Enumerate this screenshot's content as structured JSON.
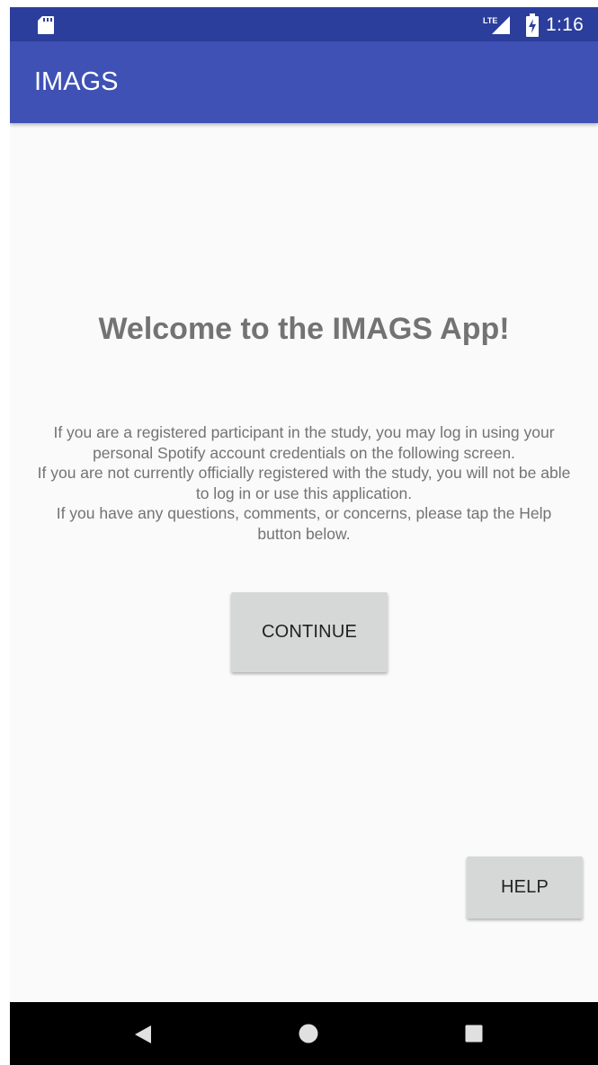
{
  "status_bar": {
    "time": "1:16",
    "network_label": "LTE",
    "icons": [
      "sd-card-icon",
      "lte-signal-icon",
      "battery-charging-icon"
    ]
  },
  "app_bar": {
    "title": "IMAGS"
  },
  "main": {
    "welcome_title": "Welcome to the IMAGS App!",
    "description_lines": [
      "If you are a registered participant in the study, you may log in using your personal Spotify account credentials on the following screen.",
      "If you are not currently officially registered with the study, you will not be able to log in or use this application.",
      "If you have any questions, comments, or concerns, please tap the Help button below."
    ],
    "continue_label": "CONTINUE",
    "help_label": "HELP"
  },
  "nav_bar": {
    "icons": [
      "back-icon",
      "home-icon",
      "recents-icon"
    ]
  },
  "colors": {
    "status_bar": "#2c3e9c",
    "app_bar": "#3f51b5",
    "background": "#fafafa",
    "button": "#d6d7d7",
    "text_gray": "#737373",
    "nav_bar": "#000000"
  }
}
